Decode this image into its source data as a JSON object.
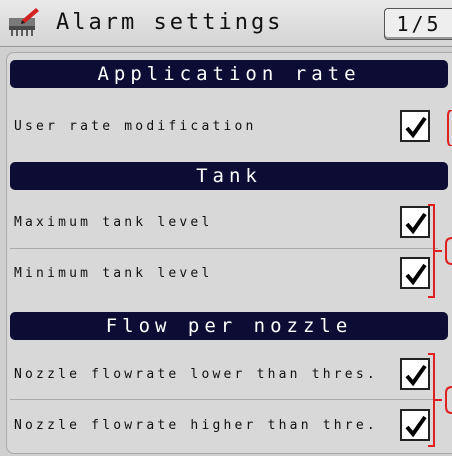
{
  "header": {
    "title": "Alarm settings",
    "page_indicator": "1/5",
    "icon": "sprayer-edit-icon"
  },
  "sections": [
    {
      "title": "Application rate",
      "items": [
        {
          "label": "User rate modification",
          "checked": true
        }
      ]
    },
    {
      "title": "Tank",
      "items": [
        {
          "label": "Maximum tank level",
          "checked": true
        },
        {
          "label": "Minimum tank level",
          "checked": true
        }
      ]
    },
    {
      "title": "Flow per nozzle",
      "items": [
        {
          "label": "Nozzle flowrate lower than thres.",
          "checked": true
        },
        {
          "label": "Nozzle flowrate higher than thre.",
          "checked": true
        }
      ]
    }
  ],
  "colors": {
    "section_header_bg": "#0c0c34",
    "bracket": "#e02020",
    "background": "#cfcfcf"
  }
}
